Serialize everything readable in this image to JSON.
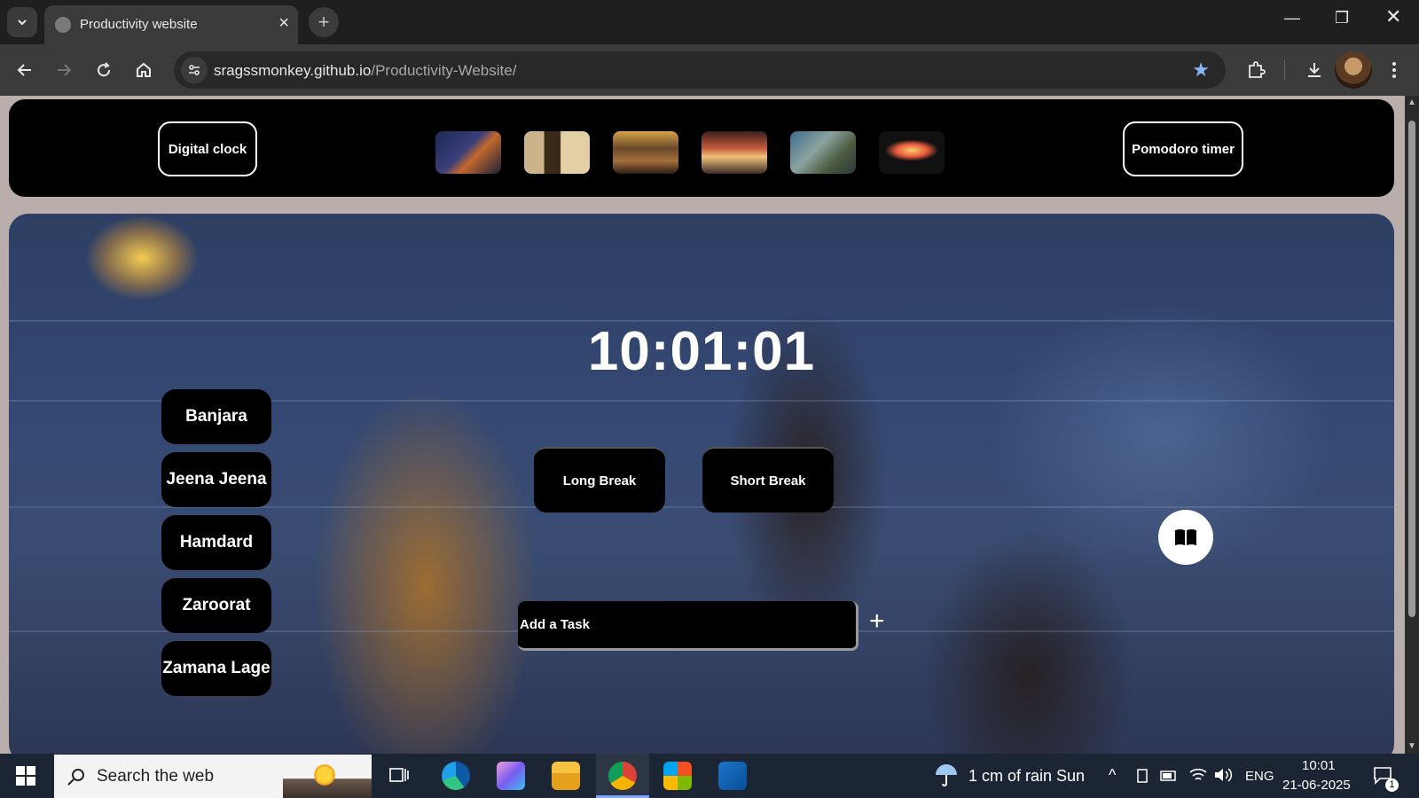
{
  "browser": {
    "tab_title": "Productivity website",
    "url_domain": "sragssmonkey.github.io",
    "url_path": "/Productivity-Website/"
  },
  "nav": {
    "left_button": "Digital clock",
    "right_button": "Pomodoro timer",
    "thumbnails": [
      "thumb-night-walk",
      "thumb-phone-book",
      "thumb-bookshop",
      "thumb-diner",
      "thumb-store",
      "thumb-carnival"
    ]
  },
  "clock": {
    "time": "10:01:01"
  },
  "songs": [
    "Banjara",
    "Jeena Jeena",
    "Hamdard",
    "Zaroorat",
    "Zamana Lage"
  ],
  "breaks": {
    "long": "Long Break",
    "short": "Short Break"
  },
  "task": {
    "placeholder": "Add a Task",
    "add_symbol": "+"
  },
  "taskbar": {
    "search_placeholder": "Search the web",
    "weather": "1 cm of rain Sun",
    "language": "ENG",
    "time": "10:01",
    "date": "21-06-2025",
    "notification_count": "1"
  },
  "colors": {
    "accent_star": "#8ab4f8",
    "nav_bg": "#000000",
    "taskbar_bg": "#1c2533"
  }
}
